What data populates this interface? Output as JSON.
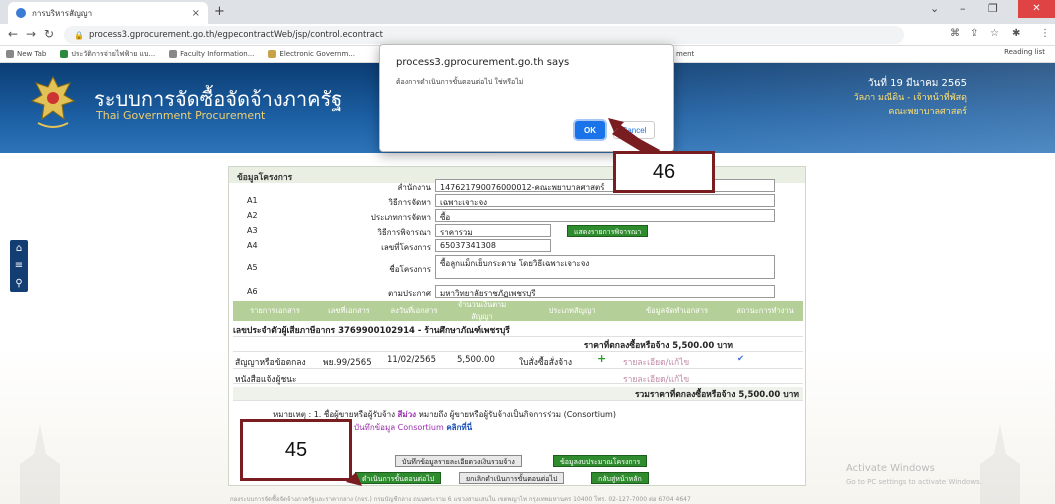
{
  "browser": {
    "tab_title": "การบริหารสัญญา",
    "url": "process3.gprocurement.go.th/egpecontractWeb/jsp/control.econtract",
    "bookmarks": [
      "New Tab",
      "ประวัติการจ่ายไฟฟ้าย แบ...",
      "Faculty Information...",
      "Electronic Governm..."
    ],
    "bookmark_end": "ment",
    "reading_list": "Reading list"
  },
  "header": {
    "title": "ระบบการจัดซื้อจัดจ้างภาครัฐ",
    "subtitle": "Thai Government Procurement",
    "date": "วันที่ 19 มีนาคม 2565",
    "user": "วัลภา มณีดิน - เจ้าหน้าที่พัสดุ",
    "org": "คณะพยาบาลศาสตร์"
  },
  "dialog": {
    "title": "process3.gprocurement.go.th says",
    "message": "ต้องการดำเนินการขั้นตอนต่อไป ใช่หรือไม่",
    "ok": "OK",
    "cancel": "Cancel"
  },
  "project": {
    "section_title": "ข้อมูลโครงการ",
    "fields": [
      {
        "code": "",
        "label": "สำนักงาน",
        "value": "147621790076000012-คณะพยาบาลศาสตร์"
      },
      {
        "code": "A1",
        "label": "วิธีการจัดหา",
        "value": "เฉพาะเจาะจง"
      },
      {
        "code": "A2",
        "label": "ประเภทการจัดหา",
        "value": "ซื้อ"
      },
      {
        "code": "A3",
        "label": "วิธีการพิจารณา",
        "value": "ราคารวม"
      },
      {
        "code": "A4",
        "label": "เลขที่โครงการ",
        "value": "65037341308"
      },
      {
        "code": "A5",
        "label": "ชื่อโครงการ",
        "value": "ซื้อลูกแม็กเย็บกระดาษ โดยวิธีเฉพาะเจาะจง"
      },
      {
        "code": "A6",
        "label": "ตามประกาศ",
        "value": "มหาวิทยาลัยราชภัฏเพชรบุรี"
      }
    ],
    "criteria_button": "แสดงรายการพิจารณา"
  },
  "table": {
    "headers": [
      "รายการเอกสาร",
      "เลขที่เอกสาร",
      "ลงวันที่เอกสาร",
      "จำนวนเงินตามสัญญา",
      "ประเภทสัญญา",
      "ข้อมูลจัดทำเอกสาร",
      "สถานะการทำงาน"
    ],
    "vendor_line": "เลขประจำตัวผู้เสียภาษีอากร 3769900102914 - ร้านศึกษาภัณฑ์เพชรบุรี",
    "agreed_price": "ราคาที่ตกลงซื้อหรือจ้าง 5,500.00 บาท",
    "rows": [
      {
        "doc": "สัญญาหรือข้อตกลง",
        "no": "พย.99/2565",
        "date": "11/02/2565",
        "amount": "5,500.00",
        "type": "ใบสั่งซื้อสั่งจ้าง",
        "action": "รายละเอียด/แก้ไข"
      },
      {
        "doc": "หนังสือแจ้งผู้ชนะ",
        "no": "",
        "date": "",
        "amount": "",
        "type": "",
        "action": "รายละเอียด/แก้ไข"
      }
    ],
    "total": "รวมราคาที่ตกลงซื้อหรือจ้าง 5,500.00 บาท"
  },
  "notes": {
    "note_prefix": "หมายเหตุ : 1. ชื่อผู้ขายหรือผู้รับจ้าง",
    "note_purple": "สีม่วง",
    "note_suffix": "หมายถึง ผู้ขายหรือผู้รับจ้างเป็นกิจการร่วม (Consortium)",
    "consortium": "บันทึกข้อมูล Consortium",
    "click_here": "คลิกที่นี่"
  },
  "buttons": {
    "save_budget": "บันทึกข้อมูลรายละเอียดวงเงินรวมจ้าง",
    "project_info": "ข้อมูลงบประมาณโครงการ",
    "next_step": "ดำเนินการขั้นตอนต่อไป",
    "cancel_step": "ยกเลิกดำเนินการขั้นตอนต่อไป",
    "back": "กลับสู่หน้าหลัก"
  },
  "annotations": {
    "a46": "46",
    "a45": "45"
  },
  "watermark": {
    "line1": "Activate Windows",
    "line2": "Go to PC settings to activate Windows."
  },
  "footer": "กองระบบการจัดซื้อจัดจ้างภาครัฐและราคากลาง (กจร.) กรมบัญชีกลาง ถนนพระราม 6 แขวงสามเสนใน เขตพญาไท กรุงเทพมหานคร 10400 โทร. 02-127-7000 ต่อ 6704 4647"
}
